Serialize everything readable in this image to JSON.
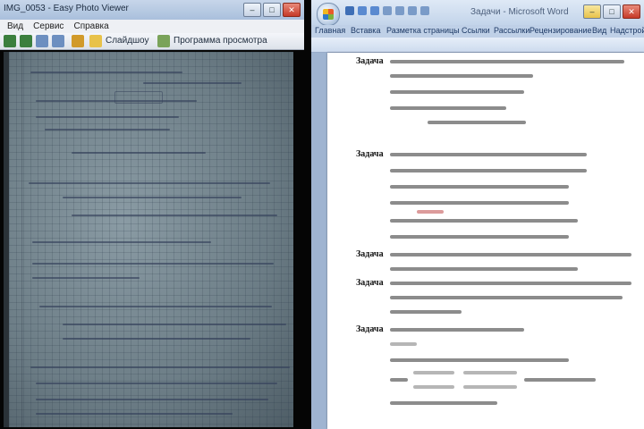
{
  "viewer": {
    "title": "IMG_0053 - Easy Photo Viewer",
    "menu": [
      "Вид",
      "Сервис",
      "Справка"
    ],
    "toolbar": {
      "slideshow_label": "Слайдшоу",
      "print_label": "Просмотр",
      "print_preview_label": "Программа просмотра"
    }
  },
  "word": {
    "title": "Задачи - Microsoft Word",
    "tabs": [
      "Главная",
      "Вставка",
      "Разметка страницы",
      "Ссылки",
      "Рассылки",
      "Рецензирование",
      "Вид",
      "Надстройки"
    ],
    "problem_labels": [
      "Задача",
      "Задача",
      "Задача",
      "Задача",
      "Задача"
    ]
  }
}
